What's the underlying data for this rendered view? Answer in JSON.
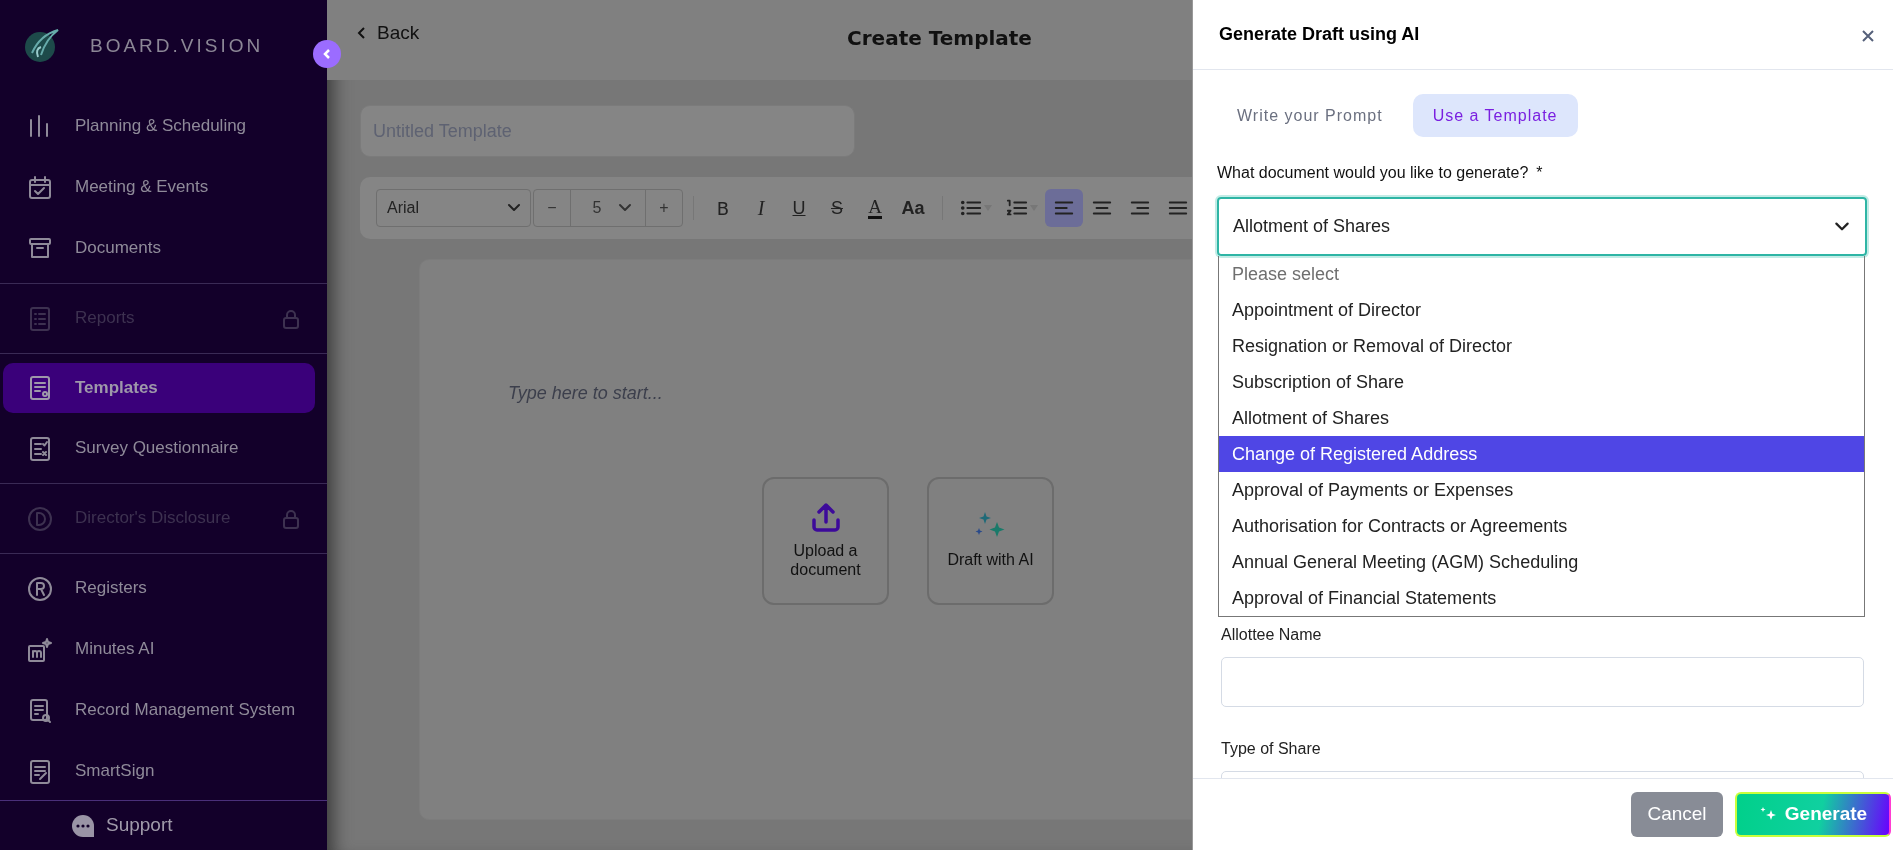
{
  "sidebar": {
    "brand": "BOARD.VISION",
    "groups": [
      [
        {
          "label": "Planning & Scheduling",
          "selected": false,
          "disabled": false
        },
        {
          "label": "Meeting & Events",
          "selected": false,
          "disabled": false
        },
        {
          "label": "Documents",
          "selected": false,
          "disabled": false
        }
      ],
      [
        {
          "label": "Reports",
          "selected": false,
          "disabled": true
        }
      ],
      [
        {
          "label": "Templates",
          "selected": true,
          "disabled": false
        },
        {
          "label": "Survey Questionnaire",
          "selected": false,
          "disabled": false
        }
      ],
      [
        {
          "label": "Director's Disclosure",
          "selected": false,
          "disabled": true
        }
      ],
      [
        {
          "label": "Registers",
          "selected": false,
          "disabled": false
        },
        {
          "label": "Minutes AI",
          "selected": false,
          "disabled": false
        },
        {
          "label": "Record Management System",
          "selected": false,
          "disabled": false
        },
        {
          "label": "SmartSign",
          "selected": false,
          "disabled": false
        }
      ]
    ],
    "support": "Support"
  },
  "main": {
    "back": "Back",
    "title": "Create Template",
    "template_name": {
      "placeholder": "Untitled Template"
    },
    "toolbar": {
      "font": "Arial",
      "size": "5",
      "minus": "−",
      "plus": "+",
      "format": [
        {
          "label": "B",
          "kind": "bold"
        },
        {
          "label": "I",
          "kind": "italic"
        },
        {
          "label": "U",
          "kind": "underline"
        },
        {
          "label": "S",
          "kind": "strike"
        },
        {
          "label": "A",
          "kind": "color"
        },
        {
          "label": "Aa",
          "kind": "case"
        }
      ],
      "tools": [
        {
          "kind": "bullets",
          "selected": false
        },
        {
          "kind": "numbers",
          "selected": false
        },
        {
          "kind": "align-left",
          "selected": true
        },
        {
          "kind": "align-center",
          "selected": false
        },
        {
          "kind": "align-right",
          "selected": false
        },
        {
          "kind": "justify",
          "selected": false
        }
      ]
    },
    "editor": {
      "placeholder": "Type here to start...",
      "actions": [
        {
          "label": "Upload a document",
          "kind": "upload"
        },
        {
          "label": "Draft with AI",
          "kind": "ai"
        }
      ]
    }
  },
  "panel": {
    "title": "Generate Draft using AI",
    "tabs": [
      {
        "label": "Write your Prompt",
        "selected": false
      },
      {
        "label": "Use a Template",
        "selected": true
      }
    ],
    "question": "What document would you like to generate?",
    "required": "*",
    "select": {
      "value": "Allotment of Shares",
      "expanded": true,
      "options": [
        {
          "label": "Please select",
          "kind": "placeholder",
          "highlighted": false
        },
        {
          "label": "Appointment of Director",
          "kind": "option",
          "highlighted": false
        },
        {
          "label": "Resignation or Removal of Director",
          "kind": "option",
          "highlighted": false
        },
        {
          "label": "Subscription of Share",
          "kind": "option",
          "highlighted": false
        },
        {
          "label": "Allotment of Shares",
          "kind": "option",
          "highlighted": false
        },
        {
          "label": "Change of Registered Address",
          "kind": "option",
          "highlighted": true
        },
        {
          "label": "Approval of Payments or Expenses",
          "kind": "option",
          "highlighted": false
        },
        {
          "label": "Authorisation for Contracts or Agreements",
          "kind": "option",
          "highlighted": false
        },
        {
          "label": "Annual General Meeting (AGM) Scheduling",
          "kind": "option",
          "highlighted": false
        },
        {
          "label": "Approval of Financial Statements",
          "kind": "option",
          "highlighted": false
        }
      ]
    },
    "fields": [
      {
        "label": "Allottee Name"
      },
      {
        "label": "Type of Share"
      }
    ],
    "buttons": [
      {
        "label": "Cancel",
        "kind": "cancel"
      },
      {
        "label": "Generate",
        "kind": "generate"
      }
    ]
  }
}
